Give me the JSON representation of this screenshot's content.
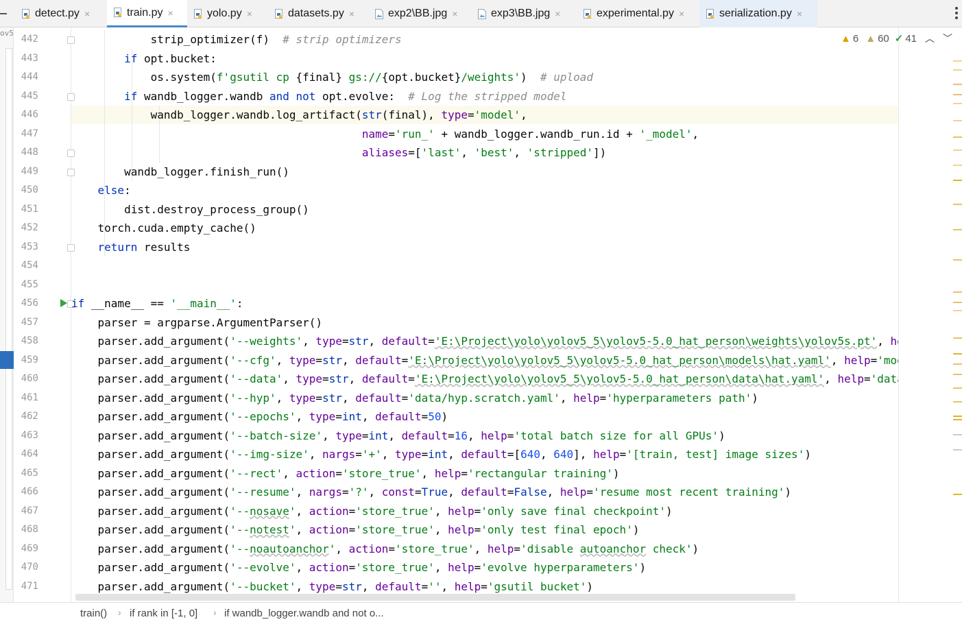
{
  "tabs": [
    {
      "label": "detect.py",
      "icon": "python-file-icon"
    },
    {
      "label": "train.py",
      "icon": "python-file-icon",
      "active": true
    },
    {
      "label": "yolo.py",
      "icon": "python-file-icon"
    },
    {
      "label": "datasets.py",
      "icon": "python-file-icon"
    },
    {
      "label": "exp2\\BB.jpg",
      "icon": "image-file-icon"
    },
    {
      "label": "exp3\\BB.jpg",
      "icon": "image-file-icon"
    },
    {
      "label": "experimental.py",
      "icon": "python-file-icon"
    },
    {
      "label": "serialization.py",
      "icon": "python-file-icon",
      "selected": true
    }
  ],
  "tab_close_glyph": "×",
  "left_strip_text": "ov5",
  "inspections": {
    "warnings": "6",
    "weak_warnings": "60",
    "typos": "41"
  },
  "line_numbers": [
    "442",
    "443",
    "444",
    "445",
    "446",
    "447",
    "448",
    "449",
    "450",
    "451",
    "452",
    "453",
    "454",
    "455",
    "456",
    "457",
    "458",
    "459",
    "460",
    "461",
    "462",
    "463",
    "464",
    "465",
    "466",
    "467",
    "468",
    "469",
    "470",
    "471"
  ],
  "code_lines": [
    [
      [
        "",
        "            strip_optimizer(f)  "
      ],
      [
        "cm",
        "# strip optimizers"
      ]
    ],
    [
      [
        "",
        "        "
      ],
      [
        "kw",
        "if"
      ],
      [
        "",
        " opt.bucket:"
      ]
    ],
    [
      [
        "",
        "            os.system("
      ],
      [
        "st",
        "f'gsutil cp "
      ],
      [
        "",
        "{final}"
      ],
      [
        "st",
        " gs://"
      ],
      [
        "",
        "{opt.bucket}"
      ],
      [
        "st",
        "/weights'"
      ],
      [
        "",
        ")  "
      ],
      [
        "cm",
        "# upload"
      ]
    ],
    [
      [
        "",
        "        "
      ],
      [
        "kw",
        "if"
      ],
      [
        "",
        " wandb_logger.wandb "
      ],
      [
        "kw",
        "and not"
      ],
      [
        "",
        " opt.evolve:  "
      ],
      [
        "cm",
        "# Log the stripped model"
      ]
    ],
    [
      [
        "",
        "            wandb_logger.wandb.log_artifact("
      ],
      [
        "bi",
        "str"
      ],
      [
        "",
        "(final), "
      ],
      [
        "pa",
        "type"
      ],
      [
        "",
        "="
      ],
      [
        "st",
        "'model'"
      ],
      [
        "",
        ","
      ]
    ],
    [
      [
        "",
        "                                            "
      ],
      [
        "pa",
        "name"
      ],
      [
        "",
        "="
      ],
      [
        "st",
        "'run_'"
      ],
      [
        "",
        " + wandb_logger.wandb_run.id + "
      ],
      [
        "st",
        "'_model'"
      ],
      [
        "",
        ","
      ]
    ],
    [
      [
        "",
        "                                            "
      ],
      [
        "pa",
        "aliases"
      ],
      [
        "",
        "=["
      ],
      [
        "st",
        "'last'"
      ],
      [
        "",
        ", "
      ],
      [
        "st",
        "'best'"
      ],
      [
        "",
        ", "
      ],
      [
        "st",
        "'stripped'"
      ],
      [
        "",
        "])"
      ]
    ],
    [
      [
        "",
        "        wandb_logger.finish_run()"
      ]
    ],
    [
      [
        "",
        "    "
      ],
      [
        "kw",
        "else"
      ],
      [
        "",
        ":"
      ]
    ],
    [
      [
        "",
        "        dist.destroy_process_group()"
      ]
    ],
    [
      [
        "",
        "    torch.cuda.empty_cache()"
      ]
    ],
    [
      [
        "",
        "    "
      ],
      [
        "kw",
        "return"
      ],
      [
        "",
        " results"
      ]
    ],
    [
      [
        "",
        ""
      ]
    ],
    [
      [
        "",
        ""
      ]
    ],
    [
      [
        "kw",
        "if"
      ],
      [
        "",
        " __name__ == "
      ],
      [
        "st",
        "'__main__'"
      ],
      [
        "",
        ":"
      ]
    ],
    [
      [
        "",
        "    parser = argparse.ArgumentParser()"
      ]
    ],
    [
      [
        "",
        "    parser.add_argument("
      ],
      [
        "st",
        "'--weights'"
      ],
      [
        "",
        ", "
      ],
      [
        "pa",
        "type"
      ],
      [
        "",
        "="
      ],
      [
        "bi",
        "str"
      ],
      [
        "",
        ", "
      ],
      [
        "pa",
        "default"
      ],
      [
        "",
        "="
      ],
      [
        "st ul",
        "'E:\\Project\\yolo\\yolov5_5\\yolov5-5.0_hat_person\\weights\\yolov5s.pt'"
      ],
      [
        "",
        ", "
      ],
      [
        "pa",
        "help"
      ],
      [
        "",
        "="
      ]
    ],
    [
      [
        "",
        "    parser.add_argument("
      ],
      [
        "st",
        "'--cfg'"
      ],
      [
        "",
        ", "
      ],
      [
        "pa",
        "type"
      ],
      [
        "",
        "="
      ],
      [
        "bi",
        "str"
      ],
      [
        "",
        ", "
      ],
      [
        "pa",
        "default"
      ],
      [
        "",
        "="
      ],
      [
        "st ul",
        "'E:\\Project\\yolo\\yolov5_5\\yolov5-5.0_hat_person\\models\\hat.yaml'"
      ],
      [
        "",
        ", "
      ],
      [
        "pa",
        "help"
      ],
      [
        "",
        "="
      ],
      [
        "st",
        "'model.yaml path'"
      ],
      [
        "",
        ")"
      ]
    ],
    [
      [
        "",
        "    parser.add_argument("
      ],
      [
        "st",
        "'--data'"
      ],
      [
        "",
        ", "
      ],
      [
        "pa",
        "type"
      ],
      [
        "",
        "="
      ],
      [
        "bi",
        "str"
      ],
      [
        "",
        ", "
      ],
      [
        "pa",
        "default"
      ],
      [
        "",
        "="
      ],
      [
        "st ul",
        "'E:\\Project\\yolo\\yolov5_5\\yolov5-5.0_hat_person\\data\\hat.yaml'"
      ],
      [
        "",
        ", "
      ],
      [
        "pa",
        "help"
      ],
      [
        "",
        "="
      ],
      [
        "st",
        "'data.yaml path'"
      ],
      [
        "",
        ")"
      ]
    ],
    [
      [
        "",
        "    parser.add_argument("
      ],
      [
        "st",
        "'--hyp'"
      ],
      [
        "",
        ", "
      ],
      [
        "pa",
        "type"
      ],
      [
        "",
        "="
      ],
      [
        "bi",
        "str"
      ],
      [
        "",
        ", "
      ],
      [
        "pa",
        "default"
      ],
      [
        "",
        "="
      ],
      [
        "st",
        "'data/hyp.scratch.yaml'"
      ],
      [
        "",
        ", "
      ],
      [
        "pa",
        "help"
      ],
      [
        "",
        "="
      ],
      [
        "st",
        "'hyperparameters path'"
      ],
      [
        "",
        ")"
      ]
    ],
    [
      [
        "",
        "    parser.add_argument("
      ],
      [
        "st",
        "'--epochs'"
      ],
      [
        "",
        ", "
      ],
      [
        "pa",
        "type"
      ],
      [
        "",
        "="
      ],
      [
        "bi",
        "int"
      ],
      [
        "",
        ", "
      ],
      [
        "pa",
        "default"
      ],
      [
        "",
        "="
      ],
      [
        "nu",
        "50"
      ],
      [
        "",
        ")"
      ]
    ],
    [
      [
        "",
        "    parser.add_argument("
      ],
      [
        "st",
        "'--batch-size'"
      ],
      [
        "",
        ", "
      ],
      [
        "pa",
        "type"
      ],
      [
        "",
        "="
      ],
      [
        "bi",
        "int"
      ],
      [
        "",
        ", "
      ],
      [
        "pa",
        "default"
      ],
      [
        "",
        "="
      ],
      [
        "nu",
        "16"
      ],
      [
        "",
        ", "
      ],
      [
        "pa",
        "help"
      ],
      [
        "",
        "="
      ],
      [
        "st",
        "'total batch size for all GPUs'"
      ],
      [
        "",
        ")"
      ]
    ],
    [
      [
        "",
        "    parser.add_argument("
      ],
      [
        "st",
        "'--img-size'"
      ],
      [
        "",
        ", "
      ],
      [
        "pa",
        "nargs"
      ],
      [
        "",
        "="
      ],
      [
        "st",
        "'+'"
      ],
      [
        "",
        ", "
      ],
      [
        "pa",
        "type"
      ],
      [
        "",
        "="
      ],
      [
        "bi",
        "int"
      ],
      [
        "",
        ", "
      ],
      [
        "pa",
        "default"
      ],
      [
        "",
        "=["
      ],
      [
        "nu",
        "640"
      ],
      [
        "",
        ", "
      ],
      [
        "nu",
        "640"
      ],
      [
        "",
        "], "
      ],
      [
        "pa",
        "help"
      ],
      [
        "",
        "="
      ],
      [
        "st",
        "'[train, test] image sizes'"
      ],
      [
        "",
        ")"
      ]
    ],
    [
      [
        "",
        "    parser.add_argument("
      ],
      [
        "st",
        "'--rect'"
      ],
      [
        "",
        ", "
      ],
      [
        "pa",
        "action"
      ],
      [
        "",
        "="
      ],
      [
        "st",
        "'store_true'"
      ],
      [
        "",
        ", "
      ],
      [
        "pa",
        "help"
      ],
      [
        "",
        "="
      ],
      [
        "st",
        "'rectangular training'"
      ],
      [
        "",
        ")"
      ]
    ],
    [
      [
        "",
        "    parser.add_argument("
      ],
      [
        "st",
        "'--resume'"
      ],
      [
        "",
        ", "
      ],
      [
        "pa",
        "nargs"
      ],
      [
        "",
        "="
      ],
      [
        "st",
        "'?'"
      ],
      [
        "",
        ", "
      ],
      [
        "pa",
        "const"
      ],
      [
        "",
        "="
      ],
      [
        "kw",
        "True"
      ],
      [
        "",
        ", "
      ],
      [
        "pa",
        "default"
      ],
      [
        "",
        "="
      ],
      [
        "kw",
        "False"
      ],
      [
        "",
        ", "
      ],
      [
        "pa",
        "help"
      ],
      [
        "",
        "="
      ],
      [
        "st",
        "'resume most recent training'"
      ],
      [
        "",
        ")"
      ]
    ],
    [
      [
        "",
        "    parser.add_argument("
      ],
      [
        "st",
        "'--"
      ],
      [
        "st ul",
        "nosave"
      ],
      [
        "st",
        "'"
      ],
      [
        "",
        ", "
      ],
      [
        "pa",
        "action"
      ],
      [
        "",
        "="
      ],
      [
        "st",
        "'store_true'"
      ],
      [
        "",
        ", "
      ],
      [
        "pa",
        "help"
      ],
      [
        "",
        "="
      ],
      [
        "st",
        "'only save final checkpoint'"
      ],
      [
        "",
        ")"
      ]
    ],
    [
      [
        "",
        "    parser.add_argument("
      ],
      [
        "st",
        "'--"
      ],
      [
        "st ul",
        "notest"
      ],
      [
        "st",
        "'"
      ],
      [
        "",
        ", "
      ],
      [
        "pa",
        "action"
      ],
      [
        "",
        "="
      ],
      [
        "st",
        "'store_true'"
      ],
      [
        "",
        ", "
      ],
      [
        "pa",
        "help"
      ],
      [
        "",
        "="
      ],
      [
        "st",
        "'only test final epoch'"
      ],
      [
        "",
        ")"
      ]
    ],
    [
      [
        "",
        "    parser.add_argument("
      ],
      [
        "st",
        "'--"
      ],
      [
        "st ul",
        "noautoanchor"
      ],
      [
        "st",
        "'"
      ],
      [
        "",
        ", "
      ],
      [
        "pa",
        "action"
      ],
      [
        "",
        "="
      ],
      [
        "st",
        "'store_true'"
      ],
      [
        "",
        ", "
      ],
      [
        "pa",
        "help"
      ],
      [
        "",
        "="
      ],
      [
        "st",
        "'disable "
      ],
      [
        "st ul",
        "autoanchor"
      ],
      [
        "st",
        " check'"
      ],
      [
        "",
        ")"
      ]
    ],
    [
      [
        "",
        "    parser.add_argument("
      ],
      [
        "st",
        "'--evolve'"
      ],
      [
        "",
        ", "
      ],
      [
        "pa",
        "action"
      ],
      [
        "",
        "="
      ],
      [
        "st",
        "'store_true'"
      ],
      [
        "",
        ", "
      ],
      [
        "pa",
        "help"
      ],
      [
        "",
        "="
      ],
      [
        "st",
        "'evolve hyperparameters'"
      ],
      [
        "",
        ")"
      ]
    ],
    [
      [
        "",
        "    parser.add_argument("
      ],
      [
        "st",
        "'--bucket'"
      ],
      [
        "",
        ", "
      ],
      [
        "pa",
        "type"
      ],
      [
        "",
        "="
      ],
      [
        "bi",
        "str"
      ],
      [
        "",
        ", "
      ],
      [
        "pa",
        "default"
      ],
      [
        "",
        "="
      ],
      [
        "st",
        "''"
      ],
      [
        "",
        ", "
      ],
      [
        "pa",
        "help"
      ],
      [
        "",
        "="
      ],
      [
        "st",
        "'gsutil bucket'"
      ],
      [
        "",
        ")"
      ]
    ]
  ],
  "breadcrumbs": [
    "train()",
    "if rank in [-1, 0]",
    "if wandb_logger.wandb and not o..."
  ],
  "colors": {
    "accent": "#4a88c7",
    "keyword": "#0033b3",
    "string": "#067d17",
    "comment": "#8c8c8c",
    "param": "#660099",
    "number": "#1750eb",
    "current_line": "#fcfaed"
  }
}
